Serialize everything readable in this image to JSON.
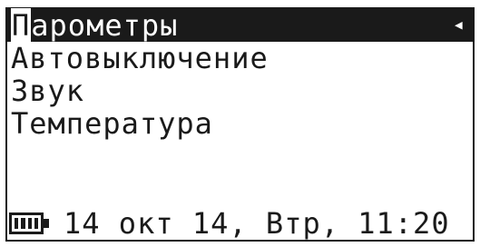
{
  "menu": {
    "items": [
      {
        "first": "П",
        "rest": "арометры"
      },
      {
        "label": "Автовыключение"
      },
      {
        "label": "Звук"
      },
      {
        "label": "Температура"
      }
    ],
    "back_arrow": "◂"
  },
  "status": {
    "battery_level": 1.0,
    "datetime": "14 окт 14, Втр, 11:20"
  },
  "colors": {
    "foreground": "#1a1a1a",
    "background": "#ffffff"
  }
}
